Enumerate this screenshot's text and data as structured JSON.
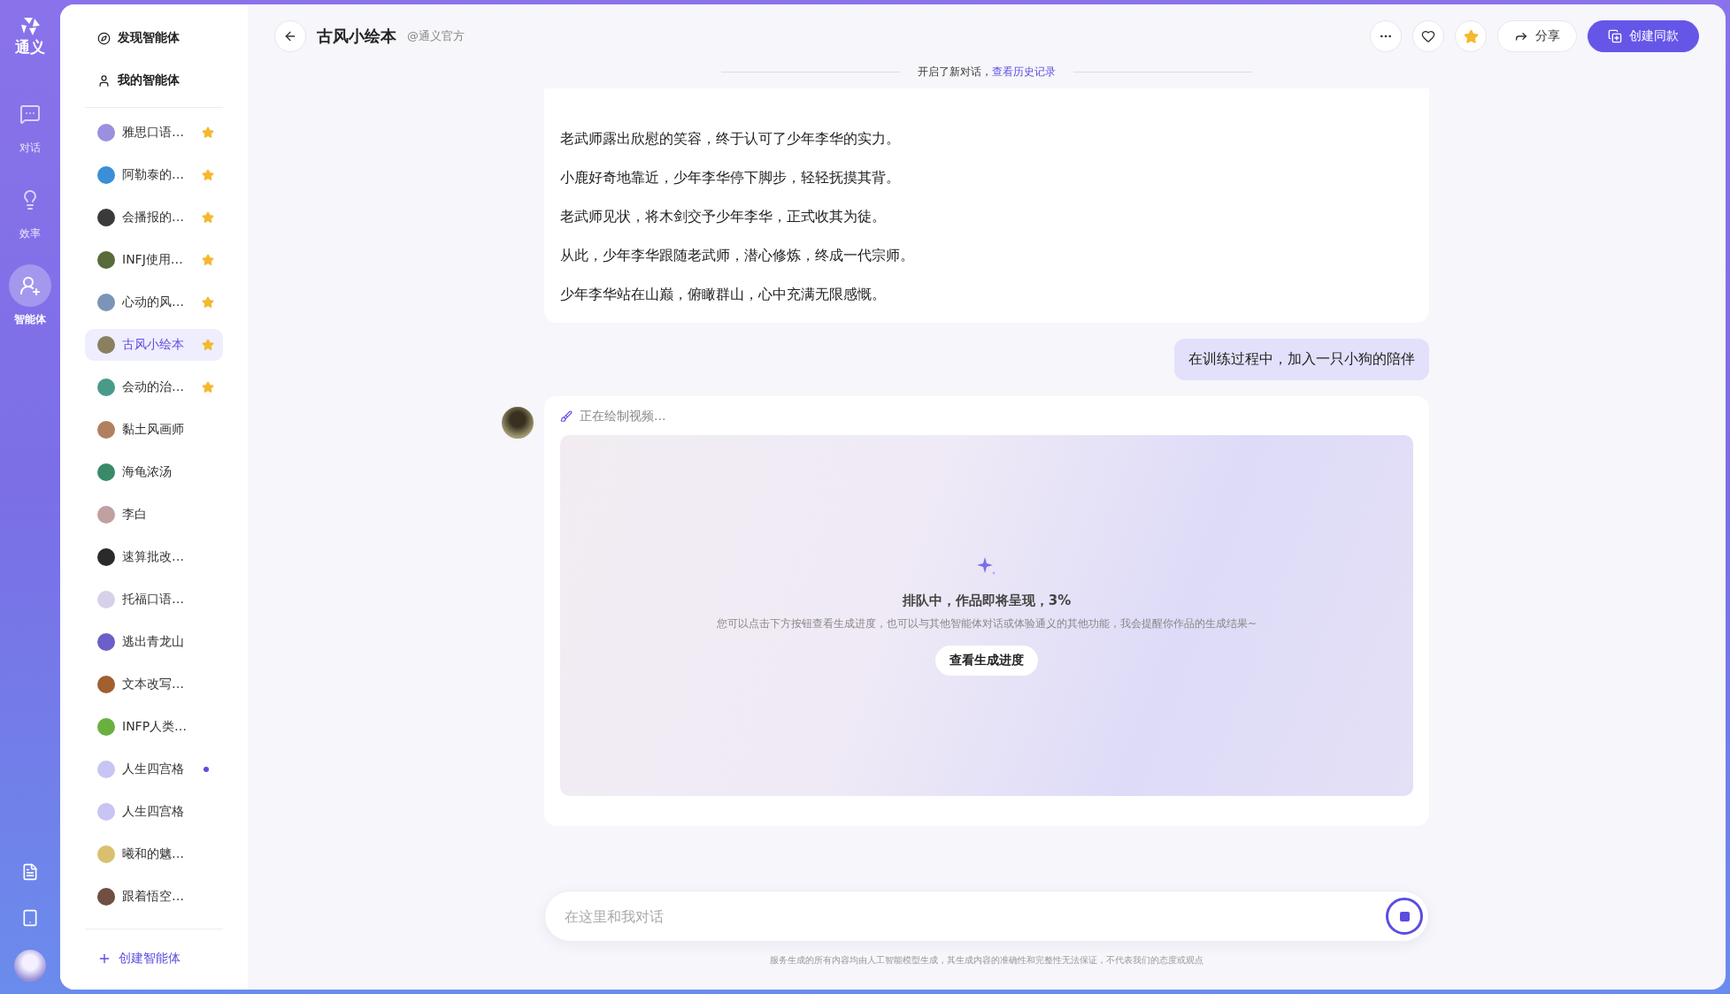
{
  "rail": {
    "logo": "通义",
    "nav": [
      {
        "label": "对话",
        "kind": "chat",
        "selected": false
      },
      {
        "label": "效率",
        "kind": "bulb",
        "selected": false
      },
      {
        "label": "智能体",
        "kind": "agent",
        "selected": true
      }
    ]
  },
  "sidebar": {
    "top": [
      {
        "label": "发现智能体",
        "kind": "discover"
      },
      {
        "label": "我的智能体",
        "kind": "mine"
      }
    ],
    "agents": [
      {
        "name": "雅思口语…",
        "starred": true,
        "unread": false,
        "selected": false,
        "color": "#9b8fe0"
      },
      {
        "name": "阿勒泰的…",
        "starred": true,
        "unread": false,
        "selected": false,
        "color": "#3a8fd8"
      },
      {
        "name": "会播报的…",
        "starred": true,
        "unread": false,
        "selected": false,
        "color": "#3a3a3a"
      },
      {
        "name": "INFJ使用…",
        "starred": true,
        "unread": false,
        "selected": false,
        "color": "#5a6b3a"
      },
      {
        "name": "心动的风…",
        "starred": true,
        "unread": false,
        "selected": false,
        "color": "#7b94b8"
      },
      {
        "name": "古风小绘本",
        "starred": true,
        "unread": false,
        "selected": true,
        "color": "#8a8060"
      },
      {
        "name": "会动的治…",
        "starred": true,
        "unread": false,
        "selected": false,
        "color": "#4a9a8a"
      },
      {
        "name": "黏土风画师",
        "starred": false,
        "unread": false,
        "selected": false,
        "color": "#b08060"
      },
      {
        "name": "海龟浓汤",
        "starred": false,
        "unread": false,
        "selected": false,
        "color": "#3a8a6a"
      },
      {
        "name": "李白",
        "starred": false,
        "unread": false,
        "selected": false,
        "color": "#c0a0a0"
      },
      {
        "name": "速算批改…",
        "starred": false,
        "unread": false,
        "selected": false,
        "color": "#2a2a2a"
      },
      {
        "name": "托福口语…",
        "starred": false,
        "unread": false,
        "selected": false,
        "color": "#d8d0e8"
      },
      {
        "name": "逃出青龙山",
        "starred": false,
        "unread": false,
        "selected": false,
        "color": "#6a60c8"
      },
      {
        "name": "文本改写…",
        "starred": false,
        "unread": false,
        "selected": false,
        "color": "#a06030"
      },
      {
        "name": "INFP人类…",
        "starred": false,
        "unread": false,
        "selected": false,
        "color": "#6ab040"
      },
      {
        "name": "人生四宫格",
        "starred": false,
        "unread": true,
        "selected": false,
        "color": "#c8c4f4"
      },
      {
        "name": "人生四宫格",
        "starred": false,
        "unread": false,
        "selected": false,
        "color": "#c8c4f4"
      },
      {
        "name": "曦和的魑…",
        "starred": false,
        "unread": false,
        "selected": false,
        "color": "#d8c070"
      },
      {
        "name": "跟着悟空…",
        "starred": false,
        "unread": false,
        "selected": false,
        "color": "#705040"
      }
    ],
    "create": "创建智能体"
  },
  "header": {
    "title": "古风小绘本",
    "author": "@通义官方",
    "favorited": true,
    "share": "分享",
    "create_same": "创建同款"
  },
  "notice": {
    "text": "开启了新对话，",
    "link": "查看历史记录"
  },
  "messages": [
    {
      "kind": "bot_text",
      "paragraphs": [
        "老武师露出欣慰的笑容，终于认可了少年李华的实力。",
        "小鹿好奇地靠近，少年李华停下脚步，轻轻抚摸其背。",
        "老武师见状，将木剑交予少年李华，正式收其为徒。",
        "从此，少年李华跟随老武师，潜心修炼，终成一代宗师。",
        "少年李华站在山巅，俯瞰群山，心中充满无限感慨。"
      ]
    },
    {
      "kind": "user",
      "text": "在训练过程中，加入一只小狗的陪伴"
    },
    {
      "kind": "bot_video",
      "status": "正在绘制视频...",
      "title": "排队中，作品即将呈现，3%",
      "desc": "您可以点击下方按钮查看生成进度，也可以与其他智能体对话或体验通义的其他功能，我会提醒你作品的生成结果~",
      "button": "查看生成进度"
    }
  ],
  "input": {
    "placeholder": "在这里和我对话"
  },
  "disclaimer": "服务生成的所有内容均由人工智能模型生成，其生成内容的准确性和完整性无法保证，不代表我们的态度或观点"
}
